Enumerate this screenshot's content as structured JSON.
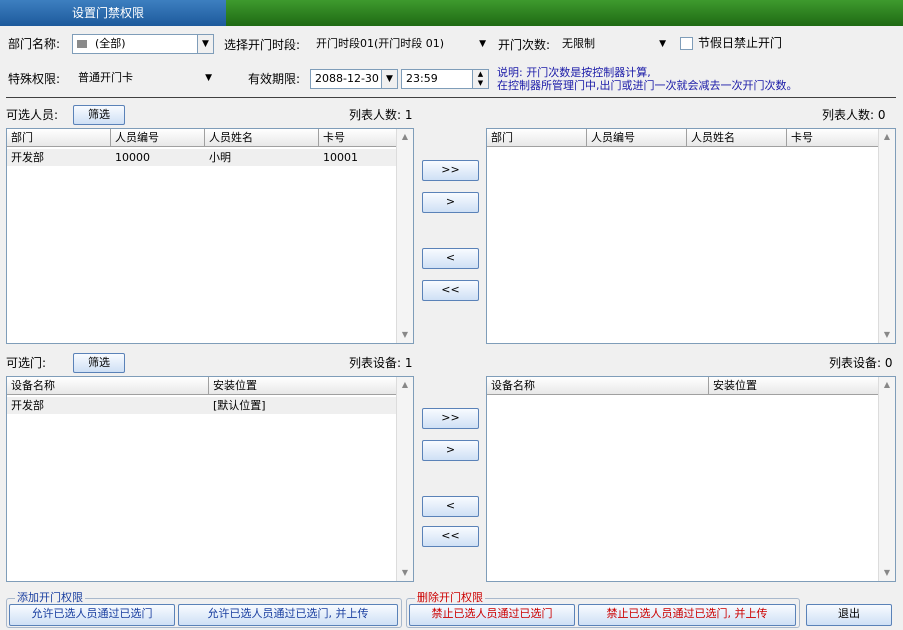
{
  "window": {
    "tab_title": "设置门禁权限"
  },
  "form": {
    "dept_label": "部门名称:",
    "dept_value": "(全部)",
    "timeseg_label": "选择开门时段:",
    "timeseg_value": "开门时段01(开门时段 01)",
    "times_label": "开门次数:",
    "times_value": "无限制",
    "holiday_label": "节假日禁止开门",
    "special_label": "特殊权限:",
    "special_value": "普通开门卡",
    "expire_label": "有效期限:",
    "expire_date": "2088-12-30",
    "expire_time": "23:59",
    "note_line1": "说明: 开门次数是按控制器计算,",
    "note_line2": "在控制器所管理门中,出门或进门一次就会减去一次开门次数。"
  },
  "people": {
    "available_label": "可选人员:",
    "filter_button": "筛选",
    "left_count": "列表人数: 1",
    "right_count": "列表人数: 0",
    "columns": [
      "部门",
      "人员编号",
      "人员姓名",
      "卡号"
    ],
    "left_rows": [
      [
        "开发部",
        "10000",
        "小明",
        "10001"
      ]
    ]
  },
  "doors": {
    "available_label": "可选门:",
    "filter_button": "筛选",
    "left_count": "列表设备: 1",
    "right_count": "列表设备: 0",
    "columns": [
      "设备名称",
      "安装位置"
    ],
    "left_rows": [
      [
        "开发部",
        "[默认位置]"
      ]
    ]
  },
  "transfer": {
    "all_right": ">>",
    "one_right": ">",
    "one_left": "<",
    "all_left": "<<"
  },
  "footer": {
    "add_group": "添加开门权限",
    "allow": "允许已选人员通过已选门",
    "allow_upload": "允许已选人员通过已选门, 并上传",
    "del_group": "删除开门权限",
    "deny": "禁止已选人员通过已选门",
    "deny_upload": "禁止已选人员通过已选门, 并上传",
    "exit": "退出"
  },
  "colors": {
    "title_green": "#2e8b1f",
    "tab_blue": "#2a6cb0",
    "note_blue": "#1a1aa8",
    "delete_red": "#cc0000"
  }
}
